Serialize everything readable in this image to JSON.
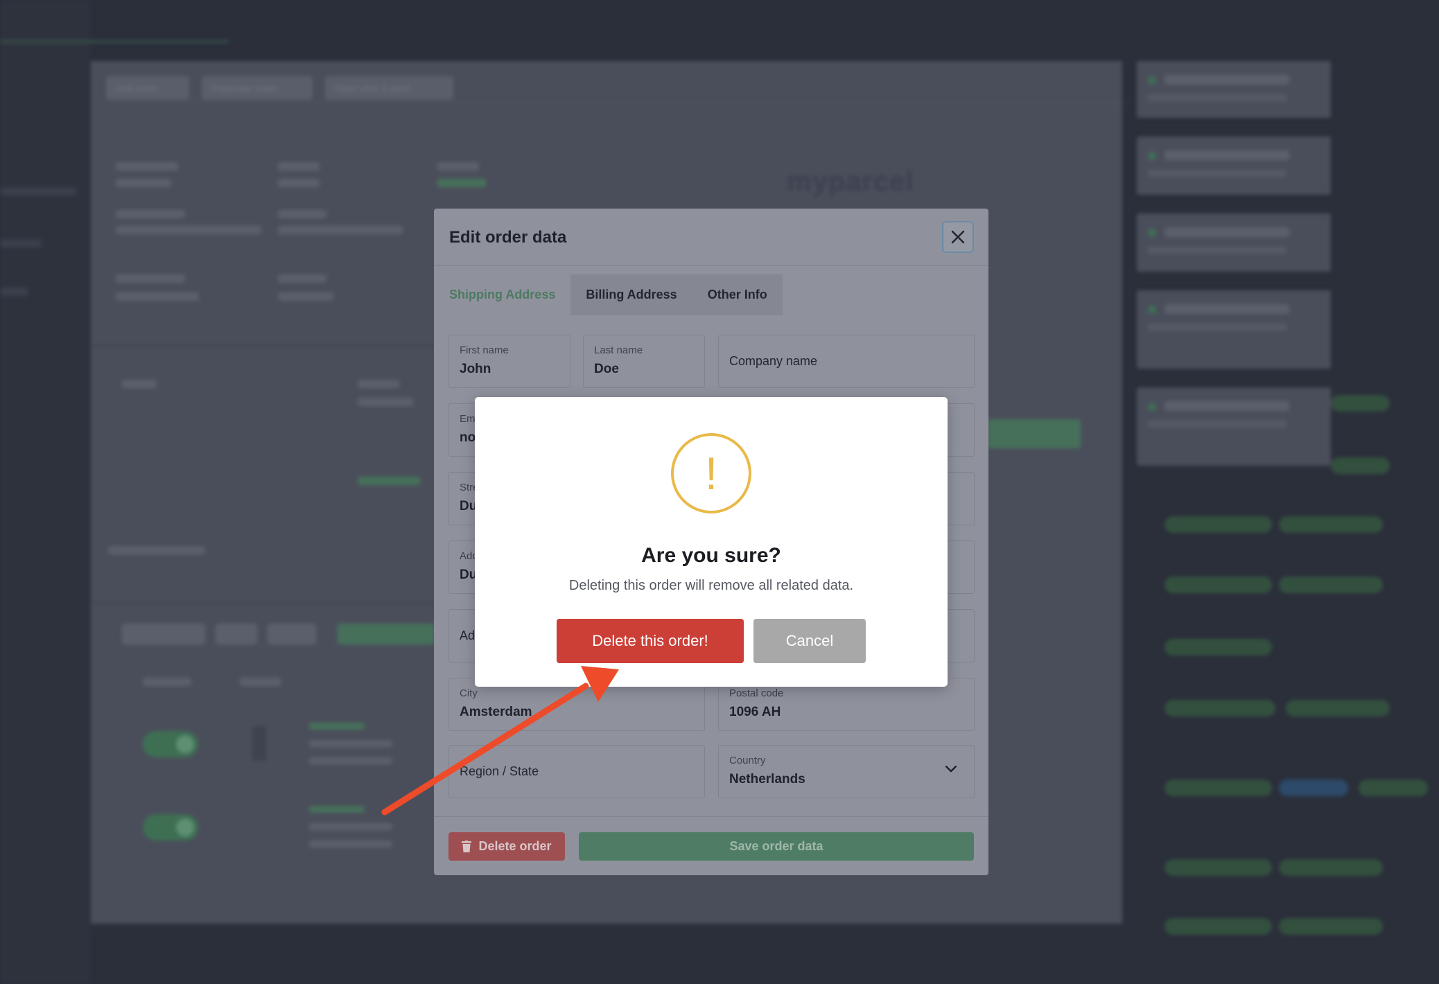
{
  "background": {
    "toolbar": [
      "Add order",
      "Duplicate order",
      "Open pick & pack"
    ],
    "logo_text": "myparcel"
  },
  "edit_modal": {
    "title": "Edit order data",
    "tabs": [
      {
        "label": "Shipping Address",
        "active": true
      },
      {
        "label": "Billing Address",
        "active": false
      },
      {
        "label": "Other Info",
        "active": false
      }
    ],
    "fields": {
      "first_name": {
        "label": "First name",
        "value": "John"
      },
      "last_name": {
        "label": "Last name",
        "value": "Doe"
      },
      "company": {
        "placeholder": "Company name"
      },
      "email": {
        "label": "Em",
        "value": "no"
      },
      "street": {
        "label": "Stre",
        "value": "Du"
      },
      "address2": {
        "label": "Add",
        "value": "Du"
      },
      "address3": {
        "placeholder": "Ad"
      },
      "city": {
        "label": "City",
        "value": "Amsterdam"
      },
      "postal_code": {
        "label": "Postal code",
        "value": "1096 AH"
      },
      "region": {
        "placeholder": "Region / State"
      },
      "country": {
        "label": "Country",
        "value": "Netherlands"
      }
    },
    "delete_label": "Delete order",
    "save_label": "Save order data"
  },
  "confirm": {
    "title": "Are you sure?",
    "message": "Deleting this order will remove all related data.",
    "delete_label": "Delete this order!",
    "cancel_label": "Cancel"
  },
  "colors": {
    "danger": "#cc3f37",
    "warning": "#e9b949",
    "success": "#4f7c64",
    "arrow": "#ee4b2b"
  }
}
